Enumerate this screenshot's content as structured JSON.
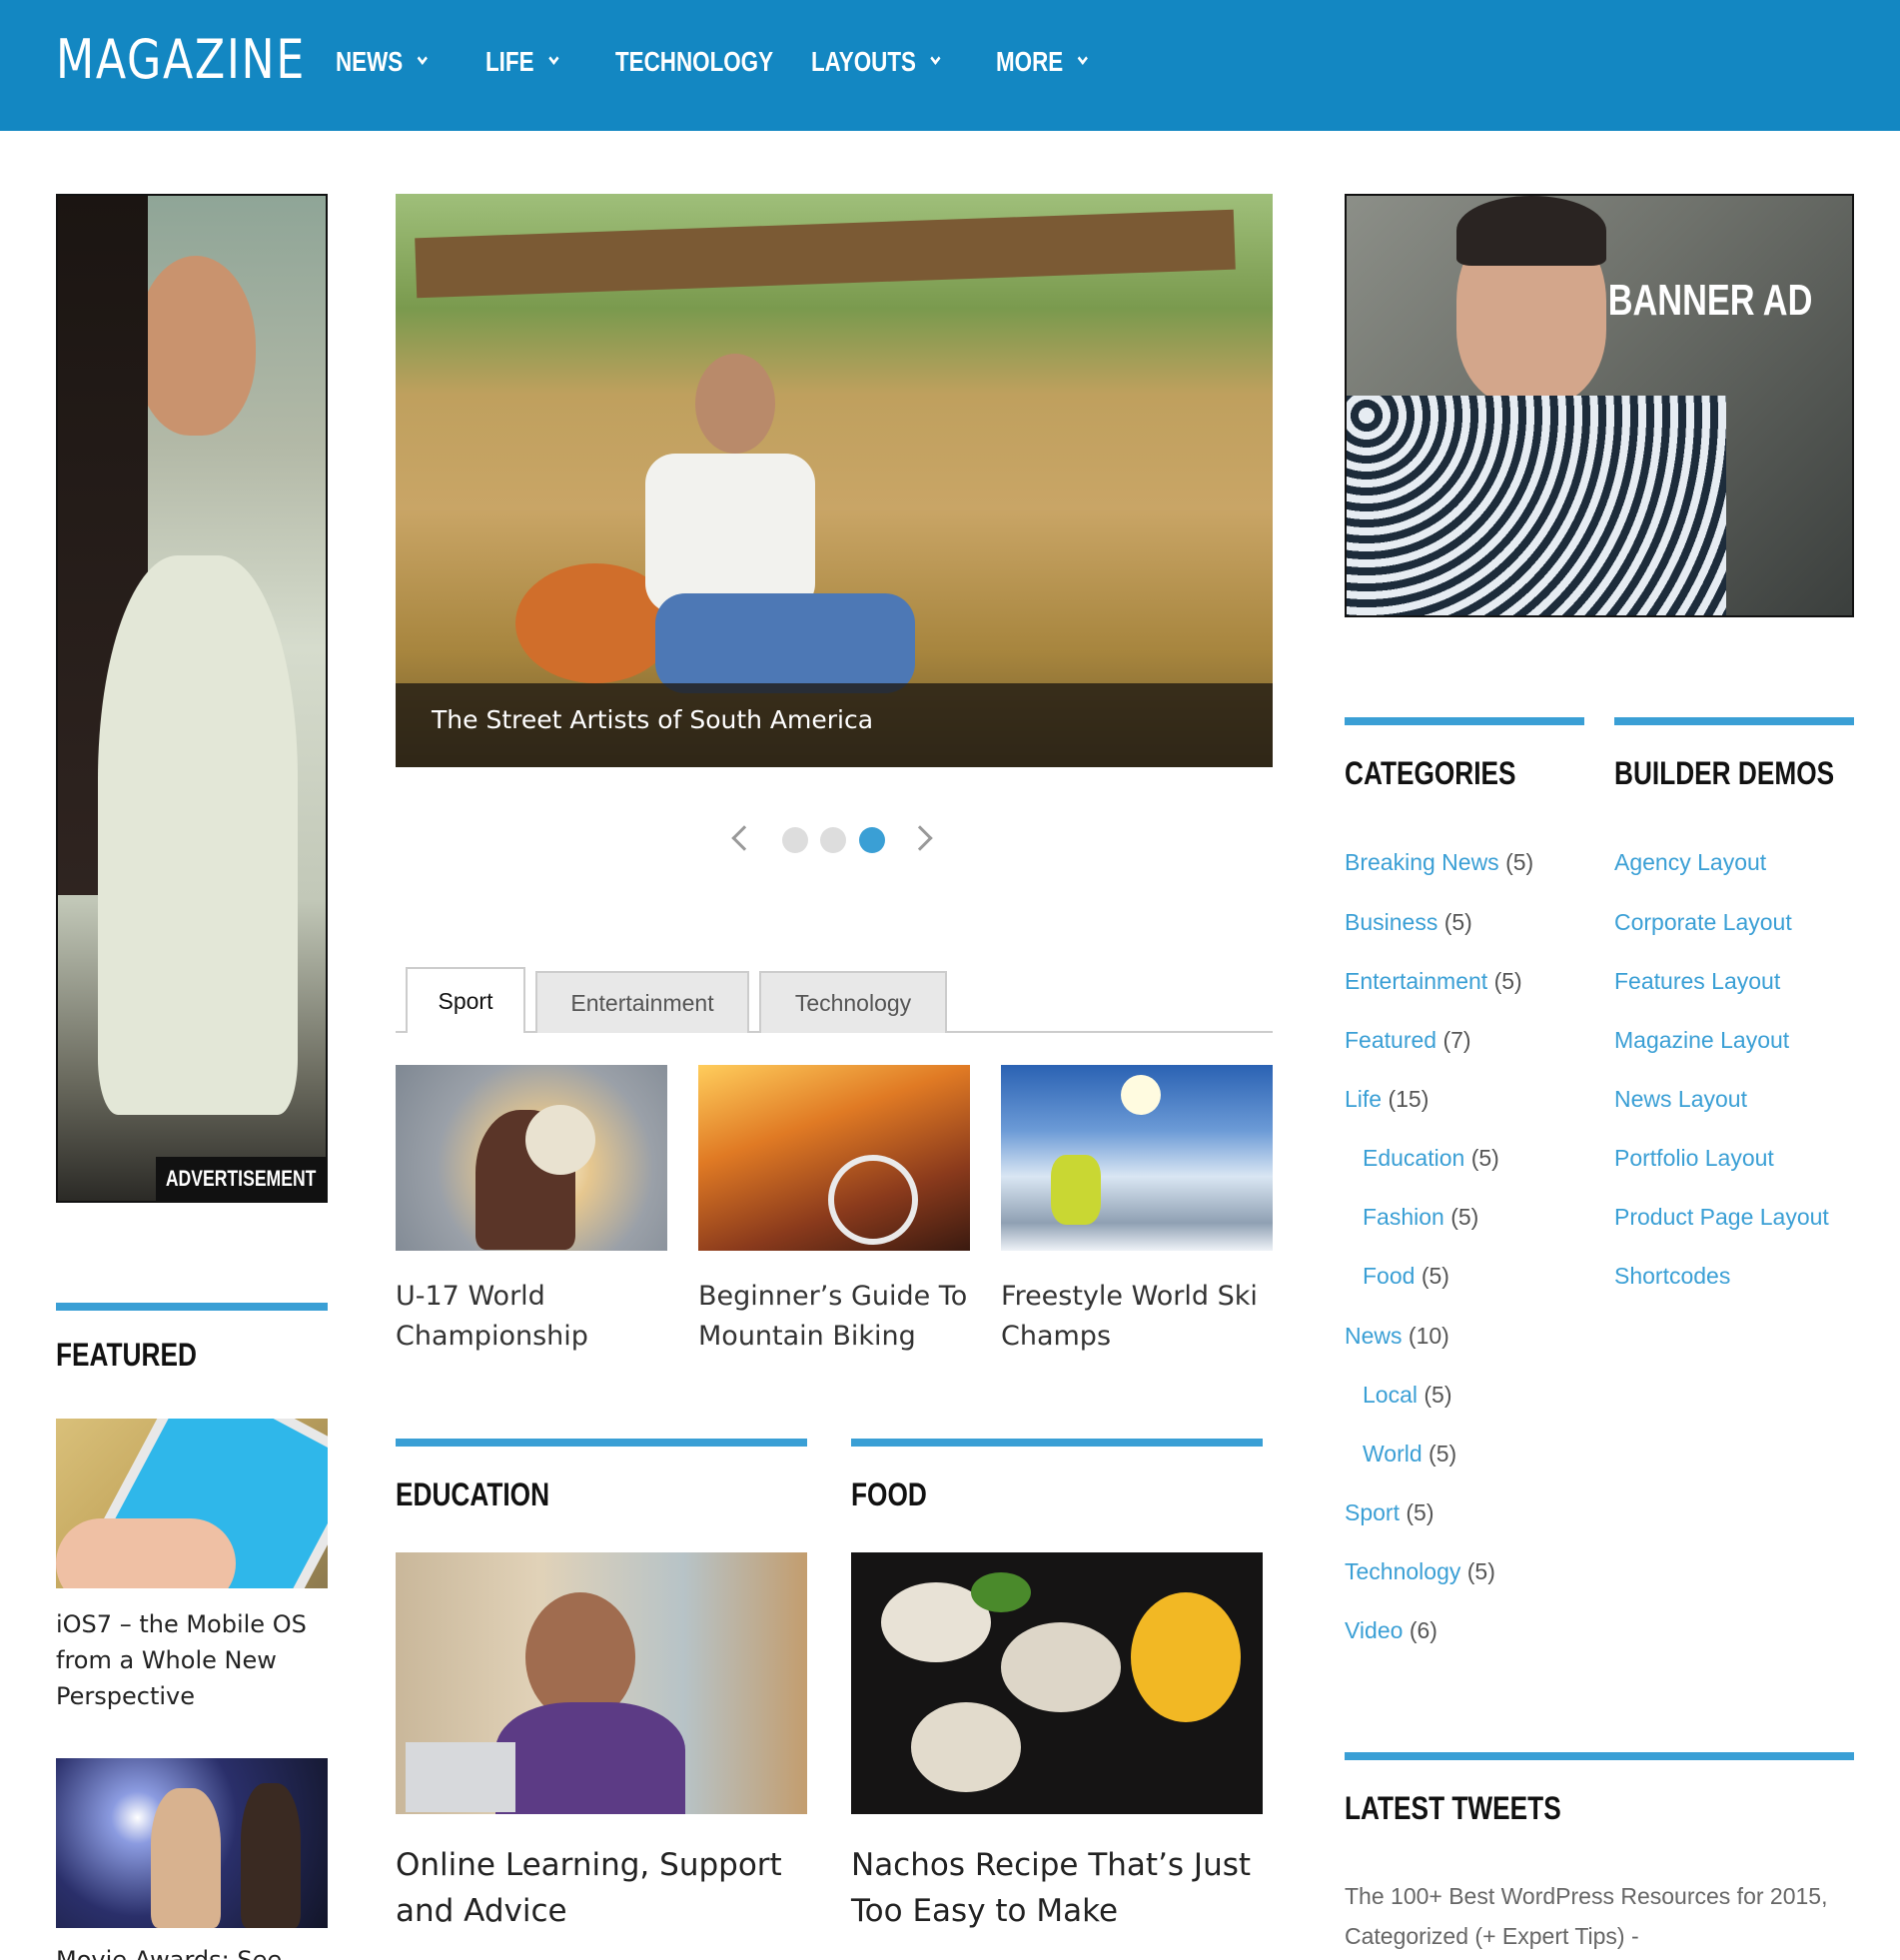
{
  "header": {
    "logo": "MAGAZINE",
    "nav": [
      {
        "label": "NEWS",
        "has_dropdown": true
      },
      {
        "label": "LIFE",
        "has_dropdown": true
      },
      {
        "label": "TECHNOLOGY",
        "has_dropdown": false
      },
      {
        "label": "LAYOUTS",
        "has_dropdown": true
      },
      {
        "label": "MORE",
        "has_dropdown": true
      }
    ]
  },
  "left": {
    "ad_label": "ADVERTISEMENT",
    "featured_heading": "FEATURED",
    "featured": [
      {
        "title": "iOS7 – the Mobile OS from a Whole New Perspective"
      },
      {
        "title": "Movie Awards: See ..."
      }
    ]
  },
  "slider": {
    "caption": "The Street Artists of South America",
    "dots": 3,
    "active_dot": 3
  },
  "tabs": {
    "items": [
      "Sport",
      "Entertainment",
      "Technology"
    ],
    "active": "Sport",
    "posts": [
      {
        "title": "U-17 World Championship"
      },
      {
        "title": "Beginner’s Guide To Mountain Biking"
      },
      {
        "title": "Freestyle World Ski Champs"
      }
    ]
  },
  "sections": [
    {
      "heading": "EDUCATION",
      "post": "Online Learning, Support and Advice"
    },
    {
      "heading": "FOOD",
      "post": "Nachos Recipe That’s Just Too Easy to Make"
    }
  ],
  "right": {
    "banner_text": "BANNER AD",
    "categories_heading": "CATEGORIES",
    "categories": [
      {
        "name": "Breaking News",
        "count": "(5)",
        "child": false
      },
      {
        "name": "Business",
        "count": "(5)",
        "child": false
      },
      {
        "name": "Entertainment",
        "count": "(5)",
        "child": false
      },
      {
        "name": "Featured",
        "count": "(7)",
        "child": false
      },
      {
        "name": "Life",
        "count": "(15)",
        "child": false
      },
      {
        "name": "Education",
        "count": "(5)",
        "child": true
      },
      {
        "name": "Fashion",
        "count": "(5)",
        "child": true
      },
      {
        "name": "Food",
        "count": "(5)",
        "child": true
      },
      {
        "name": "News",
        "count": "(10)",
        "child": false
      },
      {
        "name": "Local",
        "count": "(5)",
        "child": true
      },
      {
        "name": "World",
        "count": "(5)",
        "child": true
      },
      {
        "name": "Sport",
        "count": "(5)",
        "child": false
      },
      {
        "name": "Technology",
        "count": "(5)",
        "child": false
      },
      {
        "name": "Video",
        "count": "(6)",
        "child": false
      }
    ],
    "demos_heading": "BUILDER DEMOS",
    "demos": [
      "Agency Layout",
      "Corporate Layout",
      "Features Layout",
      "Magazine Layout",
      "News Layout",
      "Portfolio Layout",
      "Product Page Layout",
      "Shortcodes"
    ],
    "tweets_heading": "LATEST TWEETS",
    "tweet": "The 100+ Best WordPress Resources for 2015, Categorized (+ Expert Tips) -"
  },
  "colors": {
    "header_bg": "#1387c2",
    "accent": "#3a9fd5"
  }
}
